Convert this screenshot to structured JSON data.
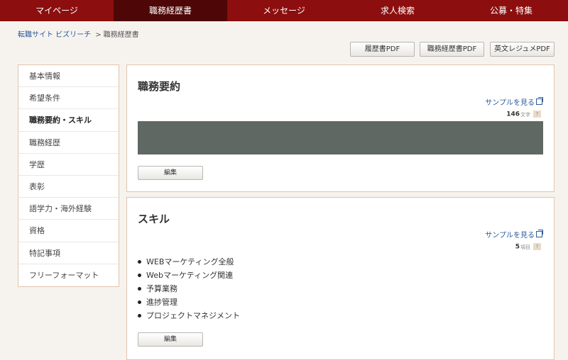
{
  "nav": {
    "items": [
      {
        "label": "マイページ",
        "active": false
      },
      {
        "label": "職務経歴書",
        "active": true
      },
      {
        "label": "メッセージ",
        "active": false
      },
      {
        "label": "求人検索",
        "active": false
      },
      {
        "label": "公募・特集",
        "active": false
      }
    ]
  },
  "breadcrumb": {
    "home": "転職サイト ビズリーチ",
    "separator": ">",
    "current": "職務経歴書"
  },
  "pdf_buttons": {
    "resume": "履歴書PDF",
    "career": "職務経歴書PDF",
    "english": "英文レジュメPDF"
  },
  "sidebar": {
    "items": [
      {
        "label": "基本情報"
      },
      {
        "label": "希望条件"
      },
      {
        "label": "職務要約・スキル"
      },
      {
        "label": "職務経歴"
      },
      {
        "label": "学歴"
      },
      {
        "label": "表彰"
      },
      {
        "label": "語学力・海外経験"
      },
      {
        "label": "資格"
      },
      {
        "label": "特記事項"
      },
      {
        "label": "フリーフォーマット"
      }
    ],
    "active_index": 2
  },
  "summary": {
    "title": "職務要約",
    "sample_link": "サンプルを見る",
    "count": "146",
    "count_unit": "文字",
    "help": "?",
    "edit": "編集"
  },
  "skills": {
    "title": "スキル",
    "sample_link": "サンプルを見る",
    "count": "5",
    "count_unit": "項目",
    "help": "?",
    "items": [
      "WEBマーケティング全般",
      "Webマーケティング関連",
      "予算業務",
      "進捗管理",
      "プロジェクトマネジメント"
    ],
    "edit": "編集"
  },
  "colors": {
    "nav_bg": "#8c0e0e",
    "nav_active": "#4e0606",
    "link": "#2a5a9b",
    "summary_fill": "#5f6862"
  },
  "icons": {
    "external": "external-link-icon",
    "help": "help-icon",
    "bullet": "bullet-icon"
  }
}
